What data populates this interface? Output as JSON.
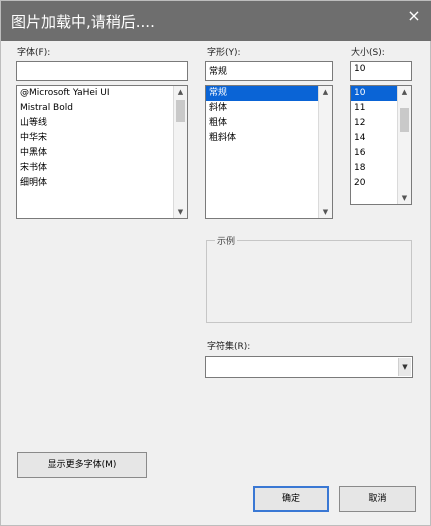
{
  "overlay": {
    "loading_text": "图片加载中,请稍后....",
    "close_glyph": "×"
  },
  "font_list": {
    "label": "字体(F):",
    "value": "",
    "items": [
      "@Microsoft YaHei UI",
      "Mistral Bold",
      "山等线",
      "中华宋",
      "中黑体",
      "宋书体",
      "细明体"
    ],
    "selected_index": -1
  },
  "style_list": {
    "label": "字形(Y):",
    "value": "常规",
    "items": [
      "常规",
      "斜体",
      "粗体",
      "粗斜体"
    ],
    "selected_index": 0
  },
  "size_list": {
    "label": "大小(S):",
    "value": "10",
    "items": [
      "10",
      "11",
      "12",
      "14",
      "16",
      "18",
      "20"
    ],
    "selected_index": 0
  },
  "preview": {
    "title": "示例"
  },
  "charset": {
    "label": "字符集(R):",
    "value": ""
  },
  "buttons": {
    "show_more": "显示更多字体(M)",
    "ok": "确定",
    "cancel": "取消"
  },
  "icons": {
    "scroll_up": "▲",
    "scroll_down": "▼",
    "dropdown": "▼"
  }
}
